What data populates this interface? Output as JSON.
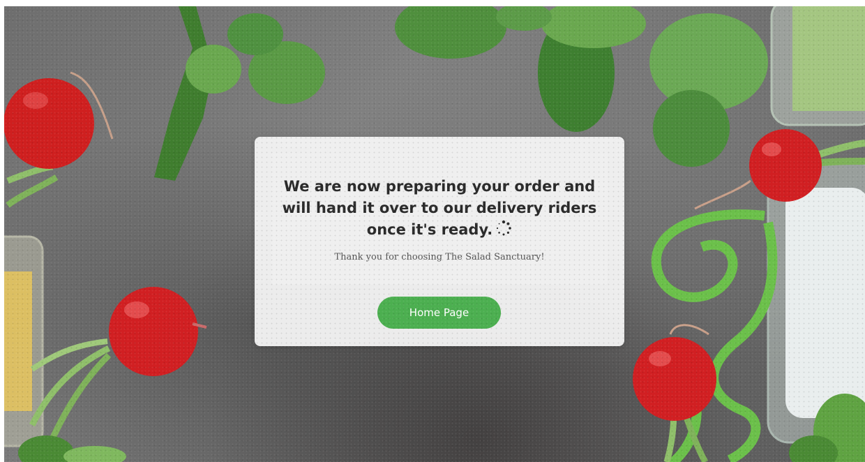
{
  "confirmation": {
    "message": "We are now preparing your order and will hand it over to our delivery riders once it's ready.",
    "thanks": "Thank you for choosing The Salad Sanctuary!",
    "loading_icon": "spinner-icon",
    "home_button_label": "Home Page"
  },
  "colors": {
    "button_background": "#4caf50",
    "button_text": "#ffffff",
    "card_background": "#f7f7f7",
    "message_text": "#2a2a2a"
  }
}
